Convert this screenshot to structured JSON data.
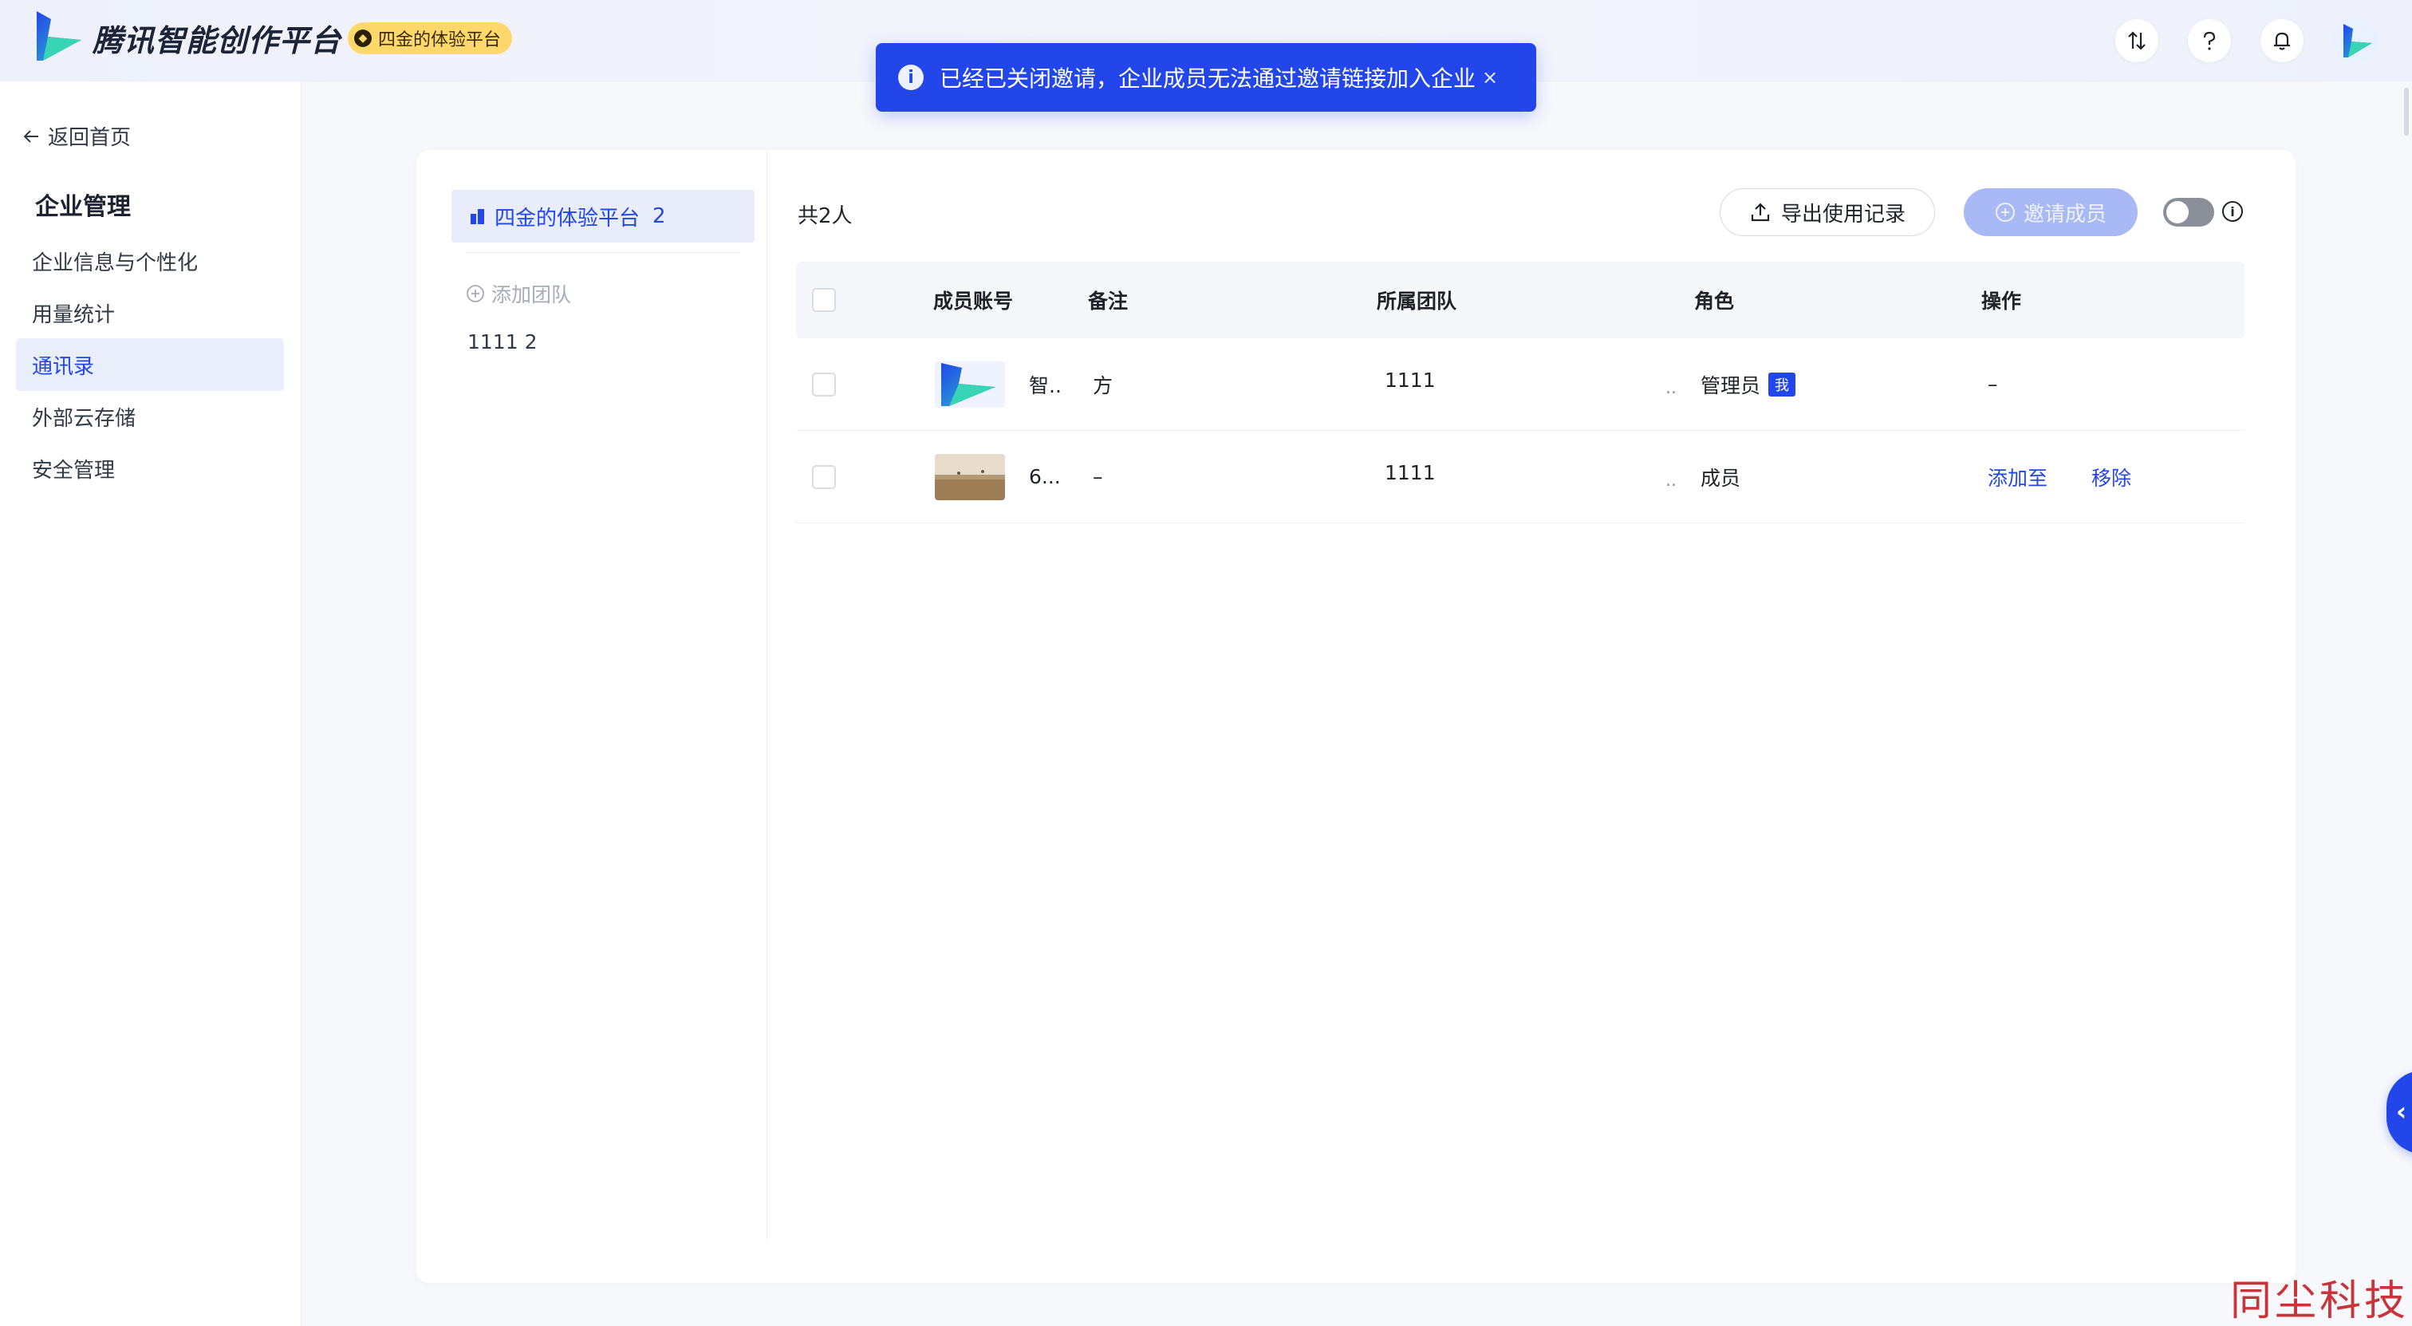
{
  "header": {
    "brand": "腾讯智能创作平台",
    "badge": "四金的体验平台",
    "badge_icon": "gem-icon"
  },
  "toast": {
    "message": "已经已关闭邀请，企业成员无法通过邀请链接加入企业",
    "close": "×"
  },
  "sidebar": {
    "back": "返回首页",
    "title": "企业管理",
    "items": [
      {
        "label": "企业信息与个性化"
      },
      {
        "label": "用量统计"
      },
      {
        "label": "通讯录",
        "active": true
      },
      {
        "label": "外部云存储"
      },
      {
        "label": "安全管理"
      }
    ]
  },
  "teams": {
    "root_name": "四金的体验平台",
    "root_count": "2",
    "add_label": "添加团队",
    "sub_team": "1111  2"
  },
  "members": {
    "total": "共2人",
    "export_label": "导出使用记录",
    "invite_label": "邀请成员",
    "columns": [
      "成员账号",
      "备注",
      "所属团队",
      "角色",
      "操作"
    ],
    "rows": [
      {
        "account": "智..",
        "note": "方",
        "team": "1111",
        "dots": "..",
        "role": "管理员",
        "tag": "我",
        "action1": "–",
        "action2": ""
      },
      {
        "account": "6...",
        "note": "–",
        "team": "1111",
        "dots": "..",
        "role": "成员",
        "tag": "",
        "action1": "添加至",
        "action2": "移除"
      }
    ]
  },
  "watermark": "同尘科技",
  "colors": {
    "accent": "#2346ea",
    "badge": "#ffd86b"
  }
}
